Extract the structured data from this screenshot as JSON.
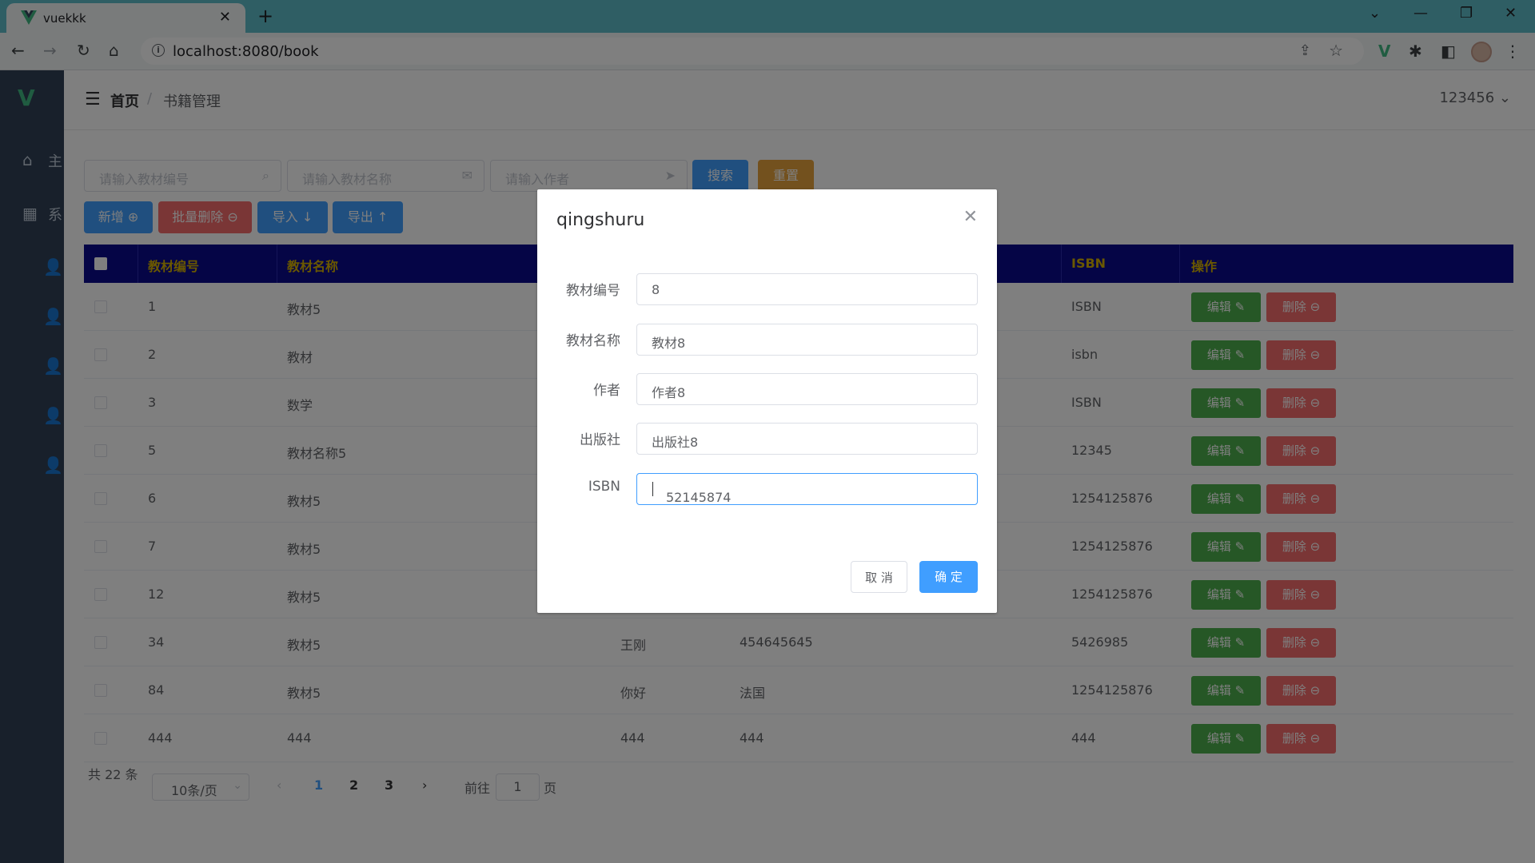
{
  "browser": {
    "tab_title": "vuekkk",
    "new_tab": "+",
    "url": "localhost:8080/book"
  },
  "sidebar": {
    "logo": "V",
    "items": [
      {
        "icon": "home-icon",
        "label": "主"
      },
      {
        "icon": "grid-icon",
        "label": "系"
      }
    ]
  },
  "header": {
    "crumb_home": "首页",
    "crumb_sep": "/",
    "crumb_current": "书籍管理",
    "username": "123456",
    "username_chevron": "⌄"
  },
  "search": {
    "id_placeholder": "请输入教材编号",
    "name_placeholder": "请输入教材名称",
    "author_placeholder": "请输入作者",
    "search_label": "搜索",
    "reset_label": "重置"
  },
  "actions": {
    "add_label": "新增 ⊕",
    "batch_delete_label": "批量删除 ⊖",
    "import_label": "导入 ↓",
    "export_label": "导出 ↑"
  },
  "table": {
    "headers": [
      "教材编号",
      "教材名称",
      "ISBN",
      "操作"
    ],
    "edit_label": "编辑 ✎",
    "delete_label": "删除 ⊖",
    "rows": [
      {
        "id": "1",
        "name": "教材5",
        "author": "",
        "publisher": "",
        "isbn": "ISBN"
      },
      {
        "id": "2",
        "name": "教材",
        "author": "",
        "publisher": "",
        "isbn": "isbn"
      },
      {
        "id": "3",
        "name": "数学",
        "author": "",
        "publisher": "",
        "isbn": "ISBN"
      },
      {
        "id": "5",
        "name": "教材名称5",
        "author": "",
        "publisher": "",
        "isbn": "12345"
      },
      {
        "id": "6",
        "name": "教材5",
        "author": "",
        "publisher": "",
        "isbn": "1254125876"
      },
      {
        "id": "7",
        "name": "教材5",
        "author": "",
        "publisher": "",
        "isbn": "1254125876"
      },
      {
        "id": "12",
        "name": "教材5",
        "author": "",
        "publisher": "",
        "isbn": "1254125876"
      },
      {
        "id": "34",
        "name": "教材5",
        "author": "王刚",
        "publisher": "454645645",
        "isbn": "5426985"
      },
      {
        "id": "84",
        "name": "教材5",
        "author": "你好",
        "publisher": "法国",
        "isbn": "1254125876"
      },
      {
        "id": "444",
        "name": "444",
        "author": "444",
        "publisher": "444",
        "isbn": "444"
      }
    ]
  },
  "pagination": {
    "total": "共 22 条",
    "page_size": "10条/页",
    "pages": [
      "1",
      "2",
      "3"
    ],
    "current_page": "1",
    "goto_prefix": "前往",
    "goto_value": "1",
    "goto_suffix": "页"
  },
  "dialog": {
    "title": "qingshuru",
    "fields": [
      {
        "label": "教材编号",
        "value": "8"
      },
      {
        "label": "教材名称",
        "value": "教材8"
      },
      {
        "label": "作者",
        "value": "作者8"
      },
      {
        "label": "出版社",
        "value": "出版社8"
      },
      {
        "label": "ISBN",
        "value": "52145874"
      }
    ],
    "cancel_label": "取 消",
    "confirm_label": "确 定"
  },
  "colors": {
    "primary": "#409eff",
    "danger": "#f56c6c",
    "success": "#4cae4c",
    "warning": "#e6a23c",
    "table_header_bg": "#0a0a8c",
    "table_header_text": "#d4b000",
    "sidebar_bg": "#304156",
    "browser_tab_bg": "#5fbcc9"
  }
}
